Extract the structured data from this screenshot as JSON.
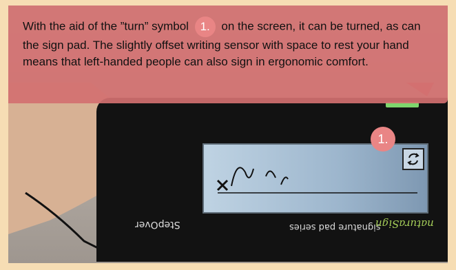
{
  "callout": {
    "text_before": "With the aid of the ”turn” symbol",
    "marker_label": "1.",
    "text_after": "on the screen, it can be turned, as can the sign pad. The slightly offset writing sensor with space to rest your hand means that left-handed people can also sign in ergonomic comfort."
  },
  "screen_marker": {
    "label": "1."
  },
  "device": {
    "brand_label": "StepOver",
    "series_label": "signature pad series",
    "logo_label": "naturaSign"
  },
  "colors": {
    "frame": "#f6ddb4",
    "callout": "#d27070",
    "marker": "#e98585",
    "led": "#7ed66d"
  },
  "icons": [
    "turn-icon",
    "led-indicator"
  ]
}
